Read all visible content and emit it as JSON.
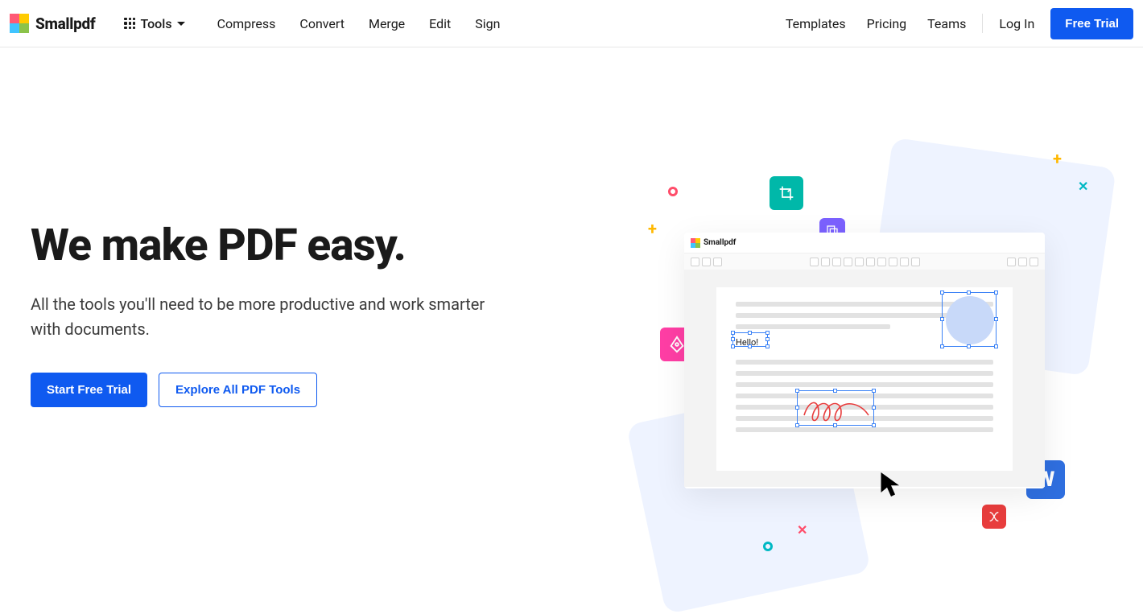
{
  "brand": "Smallpdf",
  "header": {
    "tools_label": "Tools",
    "nav": [
      "Compress",
      "Convert",
      "Merge",
      "Edit",
      "Sign"
    ],
    "secondary": [
      "Templates",
      "Pricing",
      "Teams"
    ],
    "login": "Log In",
    "cta": "Free Trial"
  },
  "hero": {
    "title": "We make PDF easy.",
    "subtitle": "All the tools you'll need to be more productive and work smarter with documents.",
    "primary_cta": "Start Free Trial",
    "secondary_cta": "Explore All PDF Tools"
  },
  "editor": {
    "brand": "Smallpdf",
    "sample_text": "Hello!"
  }
}
